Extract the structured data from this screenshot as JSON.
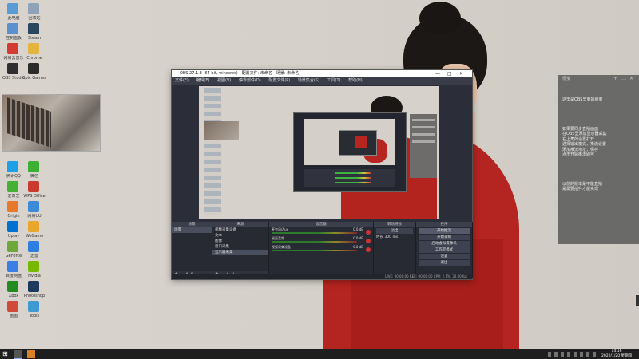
{
  "obs": {
    "title": "OBS 27.1.3 (64 bit, windows) - 配置文件: 未命名 - 场景: 未命名",
    "window_buttons": [
      "—",
      "□",
      "✕"
    ],
    "menu": [
      "文件(F)",
      "编辑(E)",
      "视图(V)",
      "停靠部件(D)",
      "配置文件(P)",
      "场景集合(S)",
      "工具(T)",
      "帮助(H)"
    ],
    "docks": {
      "scenes_title": "场景",
      "scenes": [
        "场景"
      ],
      "sources_title": "来源",
      "sources": [
        "视频采集设备",
        "文本",
        "图像",
        "窗口采集",
        "显示器采集"
      ],
      "mixer_title": "混音器",
      "mixer_tracks": [
        {
          "name": "麦克风/Aux",
          "db": "0.0 dB"
        },
        {
          "name": "桌面音频",
          "db": "0.0 dB"
        },
        {
          "name": "视频采集设备",
          "db": "0.0 dB"
        }
      ],
      "transitions_title": "转场特效",
      "transition_label": "淡出",
      "duration_label": "时长",
      "duration_value": "300 ms",
      "controls_title": "控件",
      "controls": [
        "开始推流",
        "开始录制",
        "启动虚拟摄像机",
        "工作室模式",
        "设置",
        "退出"
      ],
      "foot": "+ − ∧ ∨"
    },
    "status": "LIVE: 00:00:00    REC: 00:00:00    CPU: 2.1%, 30.00 fps"
  },
  "notes": {
    "title": "便笺",
    "buttons": [
      "+",
      "…",
      "✕"
    ],
    "paragraphs": [
      "这里是OBS里面的画面",
      "如果要同步直播画面\n在OBS里添加显示器采集\n右上角的设置打开\n选择输出模式，推流设置\n添加推流地址，保存\n点击开始推流即可",
      "以前的版本是不能直播\n是需要插件才能实现"
    ]
  },
  "desktop_icons": [
    {
      "label": "此电脑",
      "color": "#5b9bd5"
    },
    {
      "label": "回收站",
      "color": "#8fa3b8"
    },
    {
      "label": "控制面板",
      "color": "#5a8fd0"
    },
    {
      "label": "Steam",
      "color": "#2a475e"
    },
    {
      "label": "网易云音乐",
      "color": "#d33a31"
    },
    {
      "label": "Chrome",
      "color": "#e4b43c"
    },
    {
      "label": "OBS Studio",
      "color": "#302e31"
    },
    {
      "label": "Epic Games",
      "color": "#2b2b2b"
    },
    {
      "label": "腾讯QQ",
      "color": "#1ea0e8"
    },
    {
      "label": "微信",
      "color": "#3cb034"
    },
    {
      "label": "爱奇艺",
      "color": "#44b035"
    },
    {
      "label": "WPS Office",
      "color": "#c93b2f"
    },
    {
      "label": "Origin",
      "color": "#e8792c"
    },
    {
      "label": "网易UU",
      "color": "#3c8bd9"
    },
    {
      "label": "Uplay",
      "color": "#0070d1"
    },
    {
      "label": "WeGame",
      "color": "#e8a62b"
    },
    {
      "label": "GeForce",
      "color": "#6ea83a"
    },
    {
      "label": "迅雷",
      "color": "#2e7de0"
    },
    {
      "label": "百度网盘",
      "color": "#3a7de4"
    },
    {
      "label": "Nvidia",
      "color": "#76b900"
    },
    {
      "label": "Xbox",
      "color": "#228b22"
    },
    {
      "label": "Photoshop",
      "color": "#1d3a5c"
    },
    {
      "label": "画图",
      "color": "#d04a3a"
    },
    {
      "label": "Tools",
      "color": "#3f9ad1"
    }
  ],
  "taskbar": {
    "start_glyph": "⊞",
    "time": "14:16",
    "date": "2022/1/20 星期四"
  }
}
